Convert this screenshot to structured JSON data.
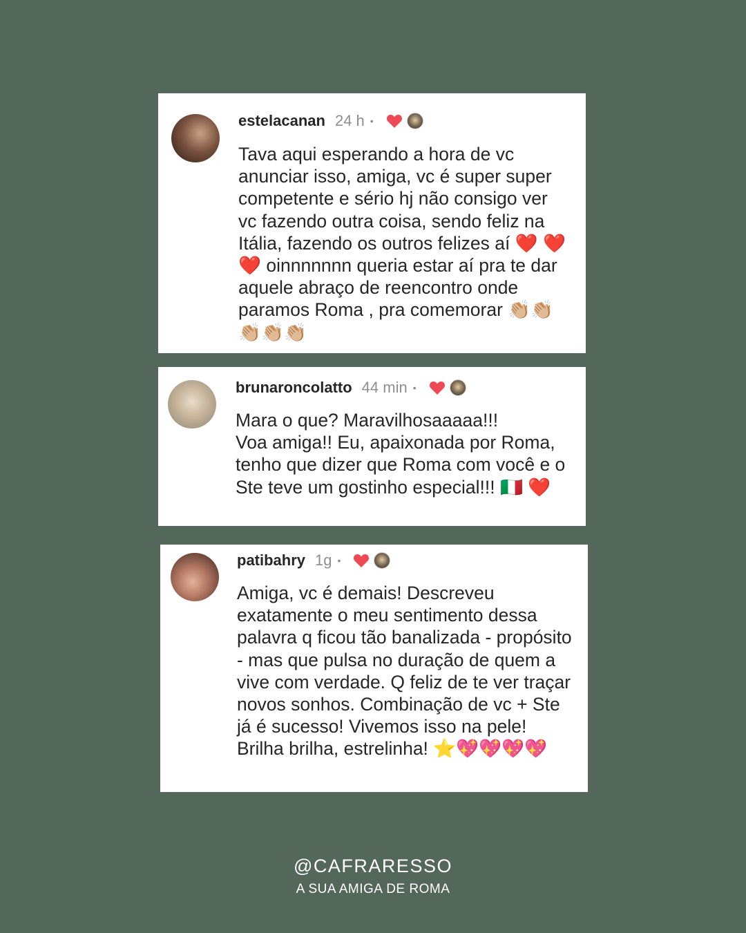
{
  "comments": [
    {
      "username": "estelacanan",
      "time": "24 h",
      "text": "Tava aqui esperando a hora de vc anunciar isso, amiga, vc é super super competente e sério hj não consigo ver vc fazendo outra coisa, sendo feliz na Itália, fazendo os outros felizes aí ❤️ ❤️❤️ oinnnnnnn queria estar aí pra te dar aquele abraço de reencontro onde paramos Roma , pra comemorar 👏🏼👏🏼 👏🏼👏🏼👏🏼"
    },
    {
      "username": "brunaroncolatto",
      "time": "44 min",
      "text": "Mara o que? Maravilhosaaaaa!!!\nVoa amiga!! Eu, apaixonada por Roma, tenho que dizer que Roma com você e o Ste teve um gostinho especial!!! 🇮🇹 ❤️"
    },
    {
      "username": "patibahry",
      "time": "1g",
      "text": "Amiga, vc é demais! Descreveu exatamente o meu sentimento dessa palavra q ficou tão banalizada - propósito - mas que pulsa no duração de quem a vive com verdade. Q feliz de te ver traçar novos sonhos. Combinação de vc + Ste já é sucesso! Vivemos isso na pele! Brilha brilha, estrelinha! ⭐💖💖💖💖"
    }
  ],
  "separator": "•",
  "footer": {
    "handle": "@CAFRARESSO",
    "tagline": "A SUA AMIGA DE ROMA"
  },
  "colors": {
    "background": "#54675b",
    "card": "#ffffff",
    "heart": "#ed4956"
  },
  "icons": {
    "like": "heart-icon",
    "liked_by_author": "author-avatar-icon"
  }
}
